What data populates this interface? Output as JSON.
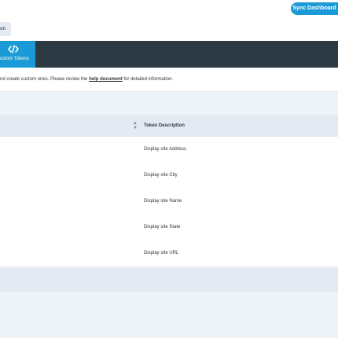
{
  "header": {
    "sync_label": "Sync Dashboard"
  },
  "breadcrumb": {
    "tab_label": "on"
  },
  "tabs": [
    {
      "label": "ustom Tokens",
      "icon": "code-icon",
      "active": true
    }
  ],
  "notice": {
    "prefix": "nd create custom ones. Please review the ",
    "link": "help document",
    "suffix": " for detailed information."
  },
  "table": {
    "columns": [
      "Token Description"
    ],
    "rows": [
      {
        "description": "Display site Address"
      },
      {
        "description": "Display site City"
      },
      {
        "description": "Display site Name"
      },
      {
        "description": "Display site State"
      },
      {
        "description": "Display site URL"
      }
    ]
  },
  "colors": {
    "accent": "#1a9bd7",
    "dark_bar": "#2d3a44",
    "background": "#eef3f8"
  }
}
